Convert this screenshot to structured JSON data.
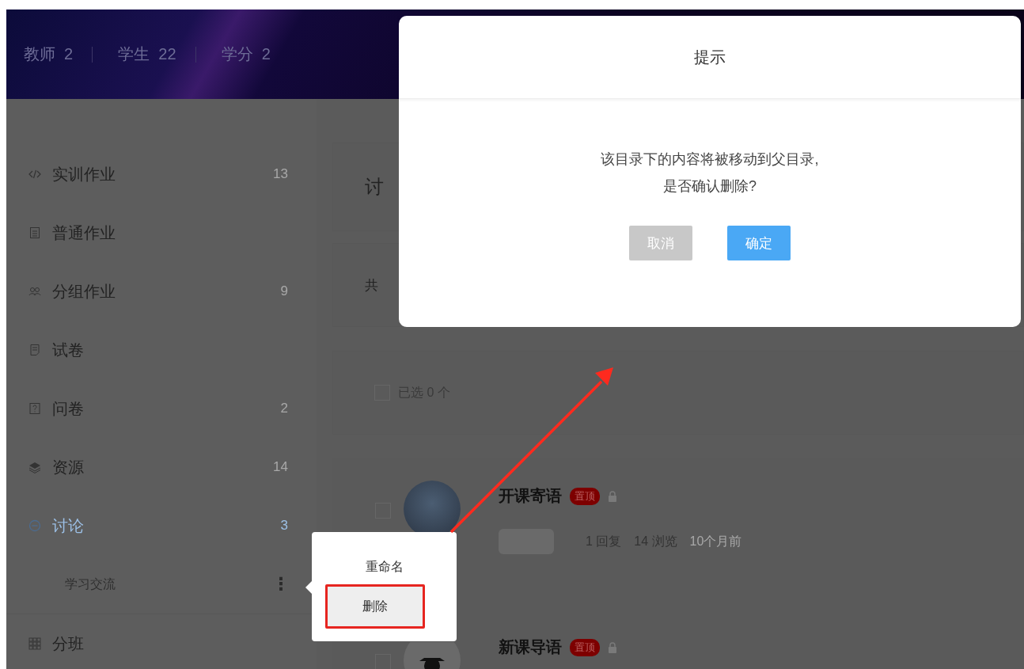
{
  "header": {
    "stats": [
      {
        "label": "教师",
        "value": "2"
      },
      {
        "label": "学生",
        "value": "22"
      },
      {
        "label": "学分",
        "value": "2"
      }
    ]
  },
  "sidebar": {
    "items": [
      {
        "label": "实训作业",
        "count": "13",
        "selected": false
      },
      {
        "label": "普通作业",
        "selected": false
      },
      {
        "label": "分组作业",
        "count": "9",
        "selected": false
      },
      {
        "label": "试卷",
        "selected": false
      },
      {
        "label": "问卷",
        "count": "2",
        "selected": false
      },
      {
        "label": "资源",
        "count": "14",
        "selected": false
      },
      {
        "label": "讨论",
        "count": "3",
        "selected": true,
        "children": [
          {
            "label": "学习交流",
            "more": "⋮"
          }
        ]
      },
      {
        "label": "分班",
        "selected": false
      }
    ]
  },
  "content": {
    "title": "讨",
    "summary": "共",
    "select_all": {
      "label": "已选 0 个",
      "checked": false
    },
    "posts": [
      {
        "title": "开课寄语",
        "badge": "置顶",
        "checked": false,
        "replies": "1 回复",
        "views": "14 浏览",
        "time": "10个月前"
      },
      {
        "title": "新课导语",
        "badge": "置顶",
        "checked": false
      }
    ]
  },
  "menu": {
    "items": [
      {
        "label": "重命名",
        "highlighted": false
      },
      {
        "label": "删除",
        "highlighted": true
      }
    ]
  },
  "dialog": {
    "title": "提示",
    "message": [
      "该目录下的内容将被移动到父目录,",
      "是否确认删除?"
    ],
    "buttons": [
      {
        "label": "取消",
        "kind": "cancel"
      },
      {
        "label": "确定",
        "kind": "primary"
      }
    ]
  }
}
